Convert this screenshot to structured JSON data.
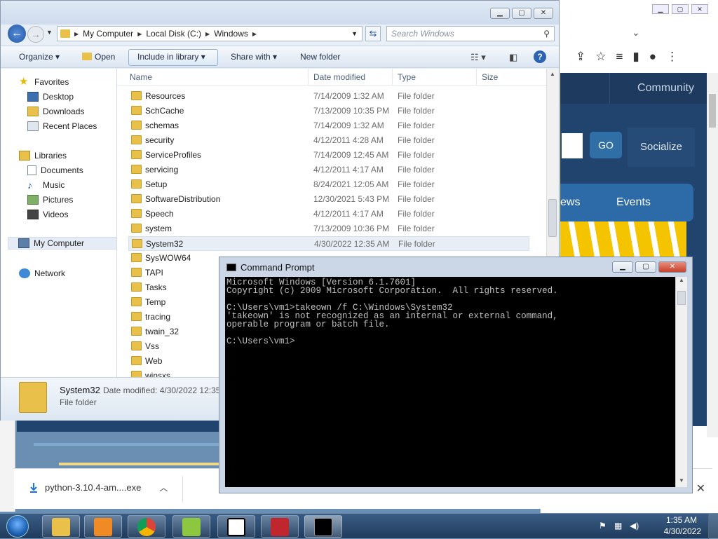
{
  "browser": {
    "nav_community": "Community",
    "go_label": "GO",
    "socialize_label": "Socialize",
    "news_label": "ews",
    "events_label": "Events",
    "download": {
      "file_name": "python-3.10.4-am....exe"
    }
  },
  "explorer": {
    "breadcrumb": [
      "My Computer",
      "Local Disk (C:)",
      "Windows"
    ],
    "search_placeholder": "Search Windows",
    "commands": {
      "organize": "Organize",
      "open": "Open",
      "include_in_library": "Include in library",
      "share_with": "Share with",
      "new_folder": "New folder"
    },
    "nav": {
      "favorites": "Favorites",
      "desktop": "Desktop",
      "downloads": "Downloads",
      "recent_places": "Recent Places",
      "libraries": "Libraries",
      "documents": "Documents",
      "music": "Music",
      "pictures": "Pictures",
      "videos": "Videos",
      "my_computer": "My Computer",
      "network": "Network"
    },
    "columns": {
      "name": "Name",
      "date_modified": "Date modified",
      "type": "Type",
      "size": "Size"
    },
    "files": [
      {
        "name": "Resources",
        "date": "7/14/2009 1:32 AM",
        "type": "File folder"
      },
      {
        "name": "SchCache",
        "date": "7/13/2009 10:35 PM",
        "type": "File folder"
      },
      {
        "name": "schemas",
        "date": "7/14/2009 1:32 AM",
        "type": "File folder"
      },
      {
        "name": "security",
        "date": "4/12/2011 4:28 AM",
        "type": "File folder"
      },
      {
        "name": "ServiceProfiles",
        "date": "7/14/2009 12:45 AM",
        "type": "File folder"
      },
      {
        "name": "servicing",
        "date": "4/12/2011 4:17 AM",
        "type": "File folder"
      },
      {
        "name": "Setup",
        "date": "8/24/2021 12:05 AM",
        "type": "File folder"
      },
      {
        "name": "SoftwareDistribution",
        "date": "12/30/2021 5:43 PM",
        "type": "File folder"
      },
      {
        "name": "Speech",
        "date": "4/12/2011 4:17 AM",
        "type": "File folder"
      },
      {
        "name": "system",
        "date": "7/13/2009 10:36 PM",
        "type": "File folder"
      },
      {
        "name": "System32",
        "date": "4/30/2022 12:35 AM",
        "type": "File folder"
      },
      {
        "name": "SysWOW64",
        "date": "",
        "type": ""
      },
      {
        "name": "TAPI",
        "date": "",
        "type": ""
      },
      {
        "name": "Tasks",
        "date": "",
        "type": ""
      },
      {
        "name": "Temp",
        "date": "",
        "type": ""
      },
      {
        "name": "tracing",
        "date": "",
        "type": ""
      },
      {
        "name": "twain_32",
        "date": "",
        "type": ""
      },
      {
        "name": "Vss",
        "date": "",
        "type": ""
      },
      {
        "name": "Web",
        "date": "",
        "type": ""
      },
      {
        "name": "winsxs",
        "date": "",
        "type": ""
      }
    ],
    "details": {
      "name": "System32",
      "modified": "Date modified: 4/30/2022 12:35",
      "type": "File folder"
    }
  },
  "cmd": {
    "title": "Command Prompt",
    "output": "Microsoft Windows [Version 6.1.7601]\nCopyright (c) 2009 Microsoft Corporation.  All rights reserved.\n\nC:\\Users\\vm1>takeown /f C:\\Windows\\System32\n'takeown' is not recognized as an internal or external command,\noperable program or batch file.\n\nC:\\Users\\vm1>"
  },
  "taskbar": {
    "time": "1:35 AM",
    "date": "4/30/2022"
  }
}
